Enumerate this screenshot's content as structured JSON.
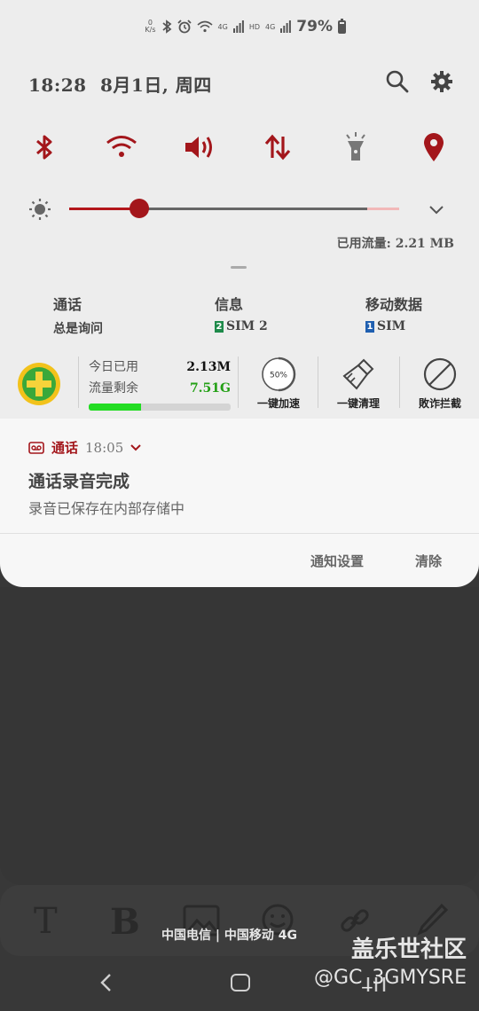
{
  "status_bar": {
    "net_speed_value": "0",
    "net_speed_unit": "K/s",
    "hd_label": "HD",
    "lte_label": "4G",
    "battery": "79%"
  },
  "header": {
    "time": "18:28",
    "date": "8月1日, 周四"
  },
  "quick_settings": [
    "bluetooth-icon",
    "wifi-icon",
    "sound-icon",
    "mobile-data-icon",
    "flashlight-icon",
    "location-icon"
  ],
  "brightness": {
    "level": 0.22
  },
  "data_usage_text": "已用流量: 2.21 MB",
  "sim_settings": [
    {
      "title": "通话",
      "value": "总是询问",
      "badge": ""
    },
    {
      "title": "信息",
      "value": "SIM 2",
      "badge": "2"
    },
    {
      "title": "移动数据",
      "value": "SIM",
      "badge": "1"
    }
  ],
  "widget_360": {
    "today_used_label": "今日已用",
    "today_used_value": "2.13M",
    "remaining_label": "流量剩余",
    "remaining_value": "7.51G",
    "usage_fraction": 0.37,
    "boost_percent": "50%",
    "boost_label": "一键加速",
    "clean_label": "一键清理",
    "block_label": "敗诈拦截"
  },
  "notification": {
    "app_name": "通话",
    "time": "18:05",
    "title": "通话录音完成",
    "body": "录音已保存在内部存储中",
    "settings_label": "通知设置",
    "clear_label": "清除"
  },
  "toolbar": {
    "text_glyph": "T",
    "bold_glyph": "B"
  },
  "carrier_text": "中国电信 | 中国移动 4G",
  "watermark": {
    "line1": "盖乐世社区",
    "line2": "@GC_3GMYSRE"
  },
  "colors": {
    "accent": "#a3161b",
    "green": "#22dc22"
  }
}
